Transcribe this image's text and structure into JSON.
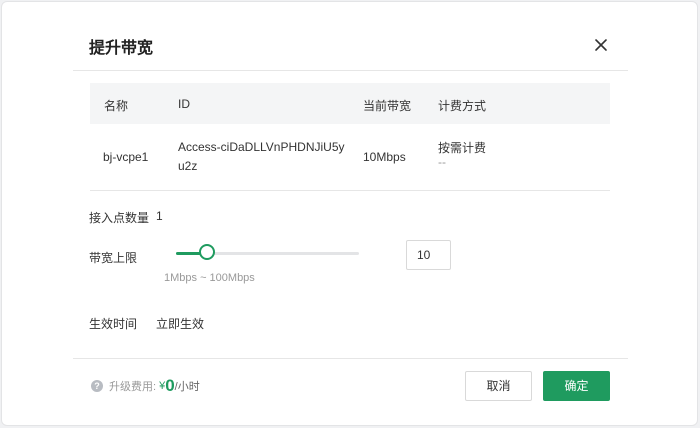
{
  "dialog": {
    "title": "提升带宽",
    "close_icon": "close-icon"
  },
  "table": {
    "headers": [
      "名称",
      "ID",
      "当前带宽",
      "计费方式"
    ],
    "row": {
      "name": "bj-vcpe1",
      "id_line1": "Access-ciDaDLLVnPHDNJiU5y",
      "id_line2": "u2z",
      "bandwidth": "10Mbps",
      "billing_line1": "按需计费",
      "billing_line2": "--"
    }
  },
  "access_points": {
    "label": "接入点数量",
    "value": "1"
  },
  "bandwidth_limit": {
    "label": "带宽上限",
    "value": "10",
    "range_hint": "1Mbps ~ 100Mbps",
    "min": 1,
    "max": 100
  },
  "effective_time": {
    "label": "生效时间",
    "value": "立即生效"
  },
  "footer": {
    "help_icon": "question-circle-icon",
    "cost_label": "升级费用:",
    "currency": "¥",
    "amount": "0",
    "unit": "/小时",
    "cancel_label": "取消",
    "confirm_label": "确定"
  },
  "colors": {
    "accent": "#1f9b5f",
    "table_header_bg": "#f4f5f6",
    "muted_text": "#999999"
  }
}
